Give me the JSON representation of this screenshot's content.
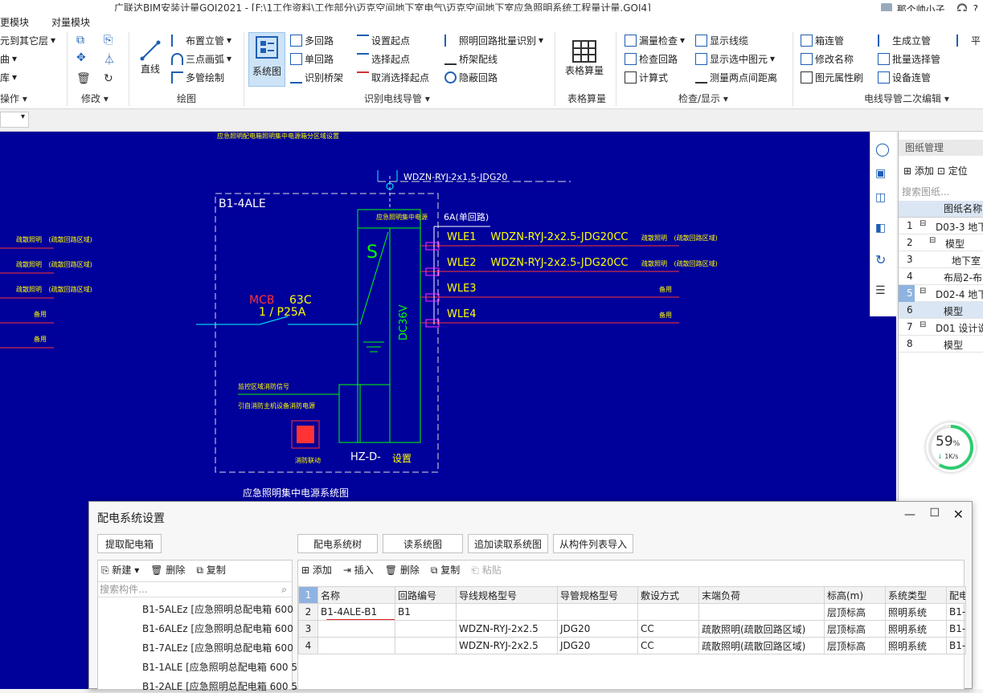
{
  "window": {
    "title": "广联达BIM安装计量GQI2021 - [F:\\1工作资料\\工作部分\\迈克空间地下室电气\\迈克空间地下室应急照明系统工程量计量.GQI4]",
    "user": "那个帅小子"
  },
  "menu": {
    "items": [
      "更模块",
      "对量模块"
    ]
  },
  "ribbon": {
    "ops": {
      "items": [
        "元到其它层",
        "曲",
        "库"
      ],
      "label": "操作"
    },
    "modify": {
      "label": "修改"
    },
    "draw": {
      "line": "直线",
      "items": [
        "布置立管",
        "三点画弧",
        "多管绘制"
      ],
      "label": "绘图"
    },
    "identify": {
      "system_btn": "系统图",
      "col1": [
        "多回路",
        "单回路",
        "识别桥架"
      ],
      "col2": [
        "设置起点",
        "选择起点",
        "取消选择起点"
      ],
      "col3": [
        "照明回路批量识别",
        "桥架配线",
        "隐蔽回路"
      ],
      "label": "识别电线导管"
    },
    "table": {
      "btn": "表格算量",
      "label": "表格算量"
    },
    "check": {
      "col1": [
        "漏量检查",
        "检查回路",
        "计算式"
      ],
      "col2": [
        "显示线缆",
        "显示选中图元",
        "测量两点间距离"
      ],
      "label": "检查/显示"
    },
    "edit2": {
      "col1": [
        "箱连管",
        "修改名称",
        "图元属性刷"
      ],
      "col2": [
        "生成立管",
        "批量选择管",
        "设备连管"
      ],
      "col3": [
        "平"
      ],
      "label": "电线导管二次编辑"
    }
  },
  "drawing_manager": {
    "title": "图纸管理",
    "add": "添加",
    "locate": "定位",
    "search_placeholder": "搜索图纸...",
    "col_header": "图纸名称",
    "rows": [
      {
        "num": "1",
        "text": "D03-3 地下"
      },
      {
        "num": "2",
        "text": "模型"
      },
      {
        "num": "3",
        "text": "地下室"
      },
      {
        "num": "4",
        "text": "布局2-布"
      },
      {
        "num": "5",
        "text": "D02-4 地下"
      },
      {
        "num": "6",
        "text": "模型"
      },
      {
        "num": "7",
        "text": "D01 设计说"
      },
      {
        "num": "8",
        "text": "模型"
      }
    ]
  },
  "speed": {
    "percent": "59",
    "unit": "%",
    "rate": "1K/s",
    "value": 0.59
  },
  "cad": {
    "top_note": "应急照明配电箱照明集中电源箱分区域设置",
    "feeder": "WDZN-RYJ-2x1.5-JDG20",
    "box_id": "B1-4ALE",
    "breaker_type": "MCB",
    "breaker_rating": "63C",
    "breaker_poles": "1 / P25A",
    "current": "6A(单回路)",
    "dc": "DC36V",
    "box_bottom": "HZ-D-",
    "box_bottom2": "设置",
    "caption": "应急照明集中电源系统图",
    "fire_label": "消防联动",
    "fire_btn": "消防",
    "left_note1": "监控区域消防信号",
    "left_note2": "引自消防主机设备消防电源",
    "circuits": [
      {
        "id": "WLE1",
        "cable": "WDZN-RYJ-2x2.5-JDG20CC",
        "load": "疏散照明",
        "area": "(疏散回路区域)"
      },
      {
        "id": "WLE2",
        "cable": "WDZN-RYJ-2x2.5-JDG20CC",
        "load": "疏散照明",
        "area": "(疏散回路区域)"
      },
      {
        "id": "WLE3",
        "cable": "",
        "load": "备用",
        "area": ""
      },
      {
        "id": "WLE4",
        "cable": "",
        "load": "备用",
        "area": ""
      }
    ],
    "left_labels": [
      {
        "a": "疏散照明",
        "b": "(疏散回路区域)"
      },
      {
        "a": "疏散照明",
        "b": "(疏散回路区域)"
      },
      {
        "a": "疏散照明",
        "b": "(疏散回路区域)"
      },
      {
        "a": "备用",
        "b": ""
      },
      {
        "a": "备用",
        "b": ""
      }
    ]
  },
  "dialog": {
    "title": "配电系统设置",
    "btn_extract": "提取配电箱",
    "btn_tree": "配电系统树",
    "btn_read": "读系统图",
    "btn_add_read": "追加读取系统图",
    "btn_import": "从构件列表导入",
    "left_toolbar": {
      "new": "新建",
      "delete": "删除",
      "copy": "复制"
    },
    "search_placeholder": "搜索构件...",
    "list": [
      "B1-5ALEz [应急照明总配电箱 600",
      "B1-6ALEz [应急照明总配电箱 600",
      "B1-7ALEz [应急照明总配电箱 600",
      "B1-1ALE [应急照明总配电箱 600 5",
      "B1-2ALE [应急照明总配电箱 600 5"
    ],
    "right_toolbar": {
      "add": "添加",
      "insert": "插入",
      "delete": "删除",
      "copy": "复制",
      "paste": "粘贴"
    },
    "columns": [
      "名称",
      "回路编号",
      "导线规格型号",
      "导管规格型号",
      "敷设方式",
      "末端负荷",
      "标高(m)",
      "系统类型",
      "配电"
    ],
    "rows": [
      {
        "num": "2",
        "cells": [
          "B1-4ALE-B1",
          "B1",
          "",
          "",
          "",
          "",
          "层顶标高",
          "照明系统",
          "B1-"
        ]
      },
      {
        "num": "3",
        "cells": [
          "",
          "",
          "WDZN-RYJ-2x2.5",
          "JDG20",
          "CC",
          "疏散照明(疏散回路区域)",
          "层顶标高",
          "照明系统",
          "B1-"
        ]
      },
      {
        "num": "4",
        "cells": [
          "",
          "",
          "WDZN-RYJ-2x2.5",
          "JDG20",
          "CC",
          "疏散照明(疏散回路区域)",
          "层顶标高",
          "照明系统",
          "B1-"
        ]
      }
    ]
  }
}
